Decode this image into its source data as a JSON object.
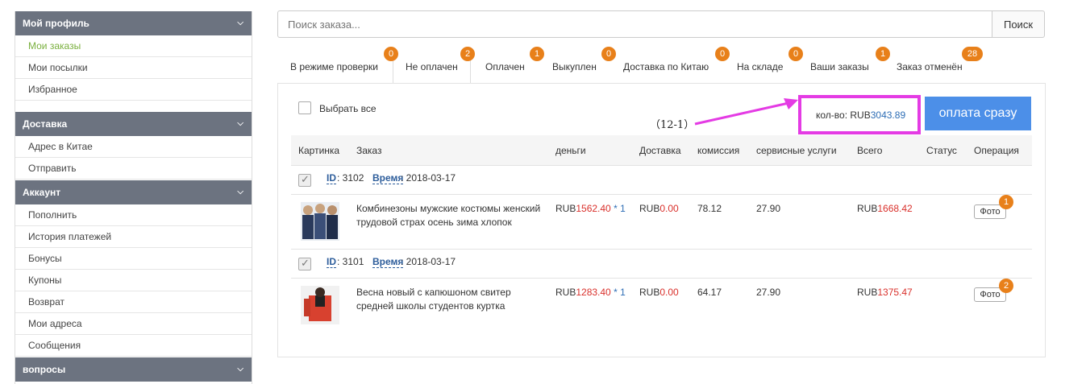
{
  "sidebar": {
    "sections": [
      {
        "title": "Мой профиль",
        "items": [
          "Мои заказы",
          "Мои посылки",
          "Избранное"
        ]
      },
      {
        "title": "Доставка",
        "items": [
          "Адрес в Китае",
          "Отправить"
        ]
      },
      {
        "title": "Аккаунт",
        "items": [
          "Пополнить",
          "История платежей",
          "Бонусы",
          "Купоны",
          "Возврат",
          "Мои адреса",
          "Сообщения"
        ]
      },
      {
        "title": "вопросы",
        "items": []
      }
    ]
  },
  "search": {
    "placeholder": "Поиск заказа...",
    "button": "Поиск"
  },
  "tabs": [
    {
      "label": "В режиме проверки",
      "count": "0"
    },
    {
      "label": "Не оплачен",
      "count": "2"
    },
    {
      "label": "Оплачен",
      "count": "1"
    },
    {
      "label": "Выкуплен",
      "count": "0"
    },
    {
      "label": "Доставка по Китаю",
      "count": "0"
    },
    {
      "label": "На складе",
      "count": "0"
    },
    {
      "label": "Ваши заказы",
      "count": "1"
    },
    {
      "label": "Заказ отменён",
      "count": "28"
    }
  ],
  "select_all": "Выбрать все",
  "annotation": "（12-1）",
  "total": {
    "label": "кол-во:",
    "currency": "RUB",
    "value": "3043.89"
  },
  "pay_button": "оплата сразу",
  "columns": [
    "Картинка",
    "Заказ",
    "деньги",
    "Доставка",
    "комиссия",
    "сервисные услуги",
    "Всего",
    "Статус",
    "Операция"
  ],
  "orders": [
    {
      "id_label": "ID",
      "id": ": 3102",
      "time_label": "Время",
      "time": ": 2018-03-17",
      "title_line1": "Комбинезоны мужские костюмы женский",
      "title_line2": "трудовой страх осень зима хлопок",
      "currency": "RUB",
      "price": "1562.40",
      "qty": " * 1",
      "shipping": "0.00",
      "commission": "78.12",
      "service": "27.90",
      "total": "1668.42",
      "photo": "Фото",
      "photo_count": "1"
    },
    {
      "id_label": "ID",
      "id": ": 3101",
      "time_label": "Время",
      "time": ": 2018-03-17",
      "title_line1": "Весна новый с капюшоном свитер",
      "title_line2": "средней школы студентов куртка",
      "currency": "RUB",
      "price": "1283.40",
      "qty": " * 1",
      "shipping": "0.00",
      "commission": "64.17",
      "service": "27.90",
      "total": "1375.47",
      "photo": "Фото",
      "photo_count": "2"
    }
  ],
  "colors": {
    "accent_green": "#7ab03e",
    "badge_orange": "#e8801a",
    "pay_blue": "#4c8fe8",
    "highlight_magenta": "#e43be4",
    "price_red": "#d9302b"
  }
}
